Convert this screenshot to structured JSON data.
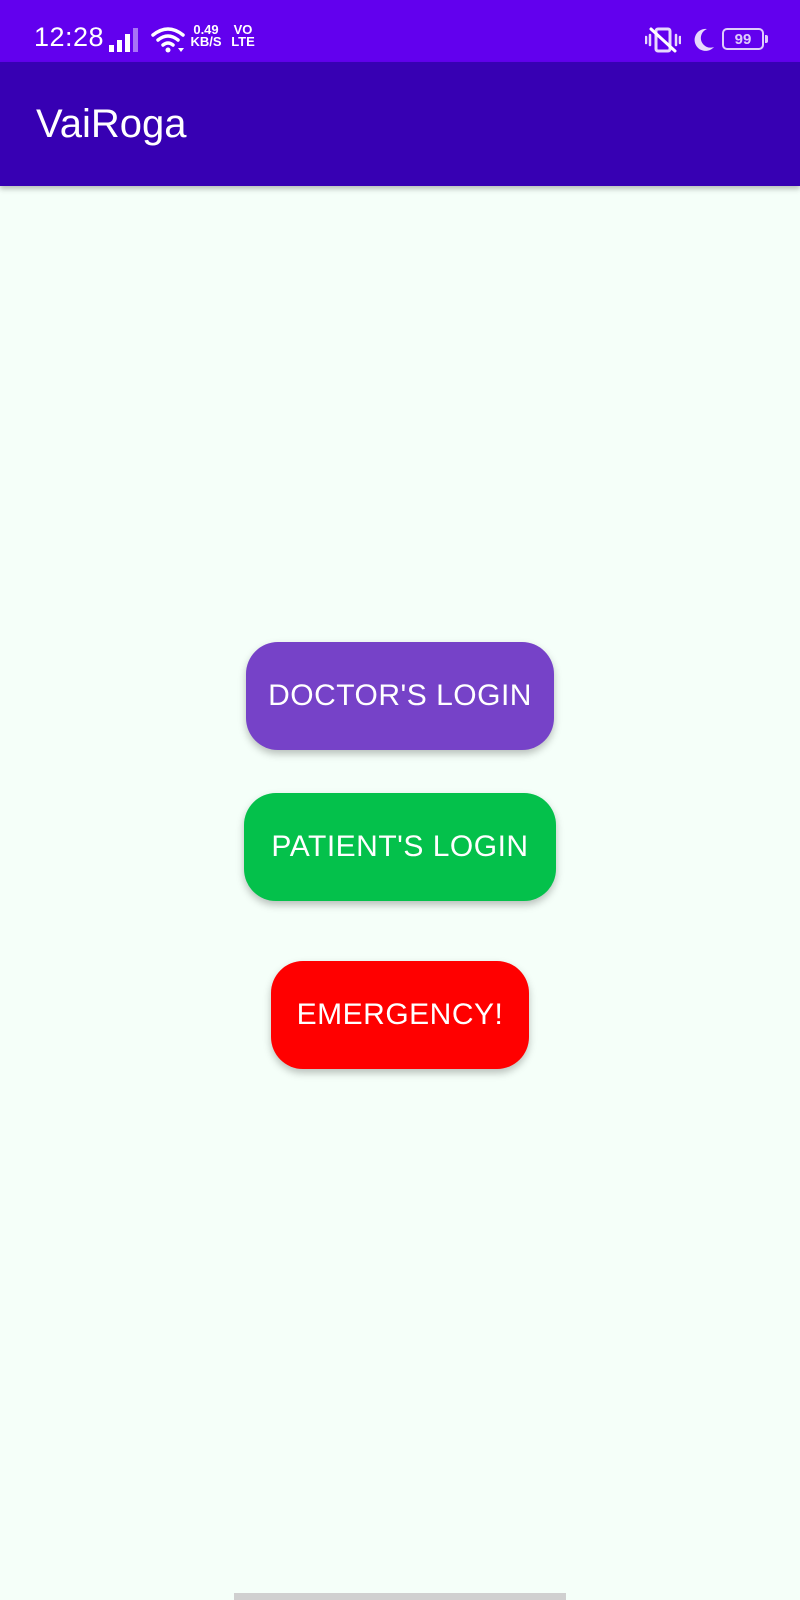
{
  "status_bar": {
    "time": "12:28",
    "net_speed_value": "0.49",
    "net_speed_unit": "KB/S",
    "volte_top": "VO",
    "volte_bottom": "LTE",
    "battery_level": "99",
    "icons": [
      "signal-icon",
      "wifi-icon",
      "vibrate-icon",
      "moon-icon",
      "battery-icon"
    ],
    "color": "#6200ee"
  },
  "app_bar": {
    "title": "VaiRoga",
    "color": "#3700b3"
  },
  "buttons": {
    "doctor_label": "DOCTOR'S LOGIN",
    "doctor_color": "#7642c8",
    "patient_label": "PATIENT'S LOGIN",
    "patient_color": "#04c14b",
    "emergency_label": "EMERGENCY!",
    "emergency_color": "#ff0000"
  },
  "background_color": "#f5fff9"
}
